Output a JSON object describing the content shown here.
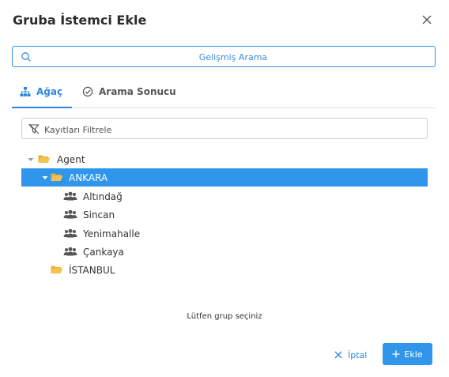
{
  "dialog": {
    "title": "Gruba İstemci Ekle"
  },
  "search": {
    "placeholder": "Gelişmiş Arama"
  },
  "tabs": [
    {
      "label": "Ağaç",
      "icon": "sitemap-icon",
      "active": true
    },
    {
      "label": "Arama Sonucu",
      "icon": "check-circle-icon",
      "active": false
    }
  ],
  "filter": {
    "placeholder": "Kayıtları Filtrele"
  },
  "tree": {
    "root": {
      "label": "Agent",
      "expanded": true
    },
    "nodes": [
      {
        "label": "ANKARA",
        "expanded": true,
        "selected": true,
        "icon": "folder-open-icon"
      },
      {
        "label": "Altındağ",
        "icon": "users-icon"
      },
      {
        "label": "Sincan",
        "icon": "users-icon"
      },
      {
        "label": "Yenimahalle",
        "icon": "users-icon"
      },
      {
        "label": "Çankaya",
        "icon": "users-icon"
      },
      {
        "label": "İSTANBUL",
        "icon": "folder-open-icon"
      }
    ]
  },
  "hint": "Lütfen grup seçiniz",
  "footer": {
    "cancel_label": "İptal",
    "add_label": "Ekle"
  },
  "colors": {
    "accent": "#2f86df",
    "selection": "#2f96eb",
    "folder": "#f6c34e"
  }
}
